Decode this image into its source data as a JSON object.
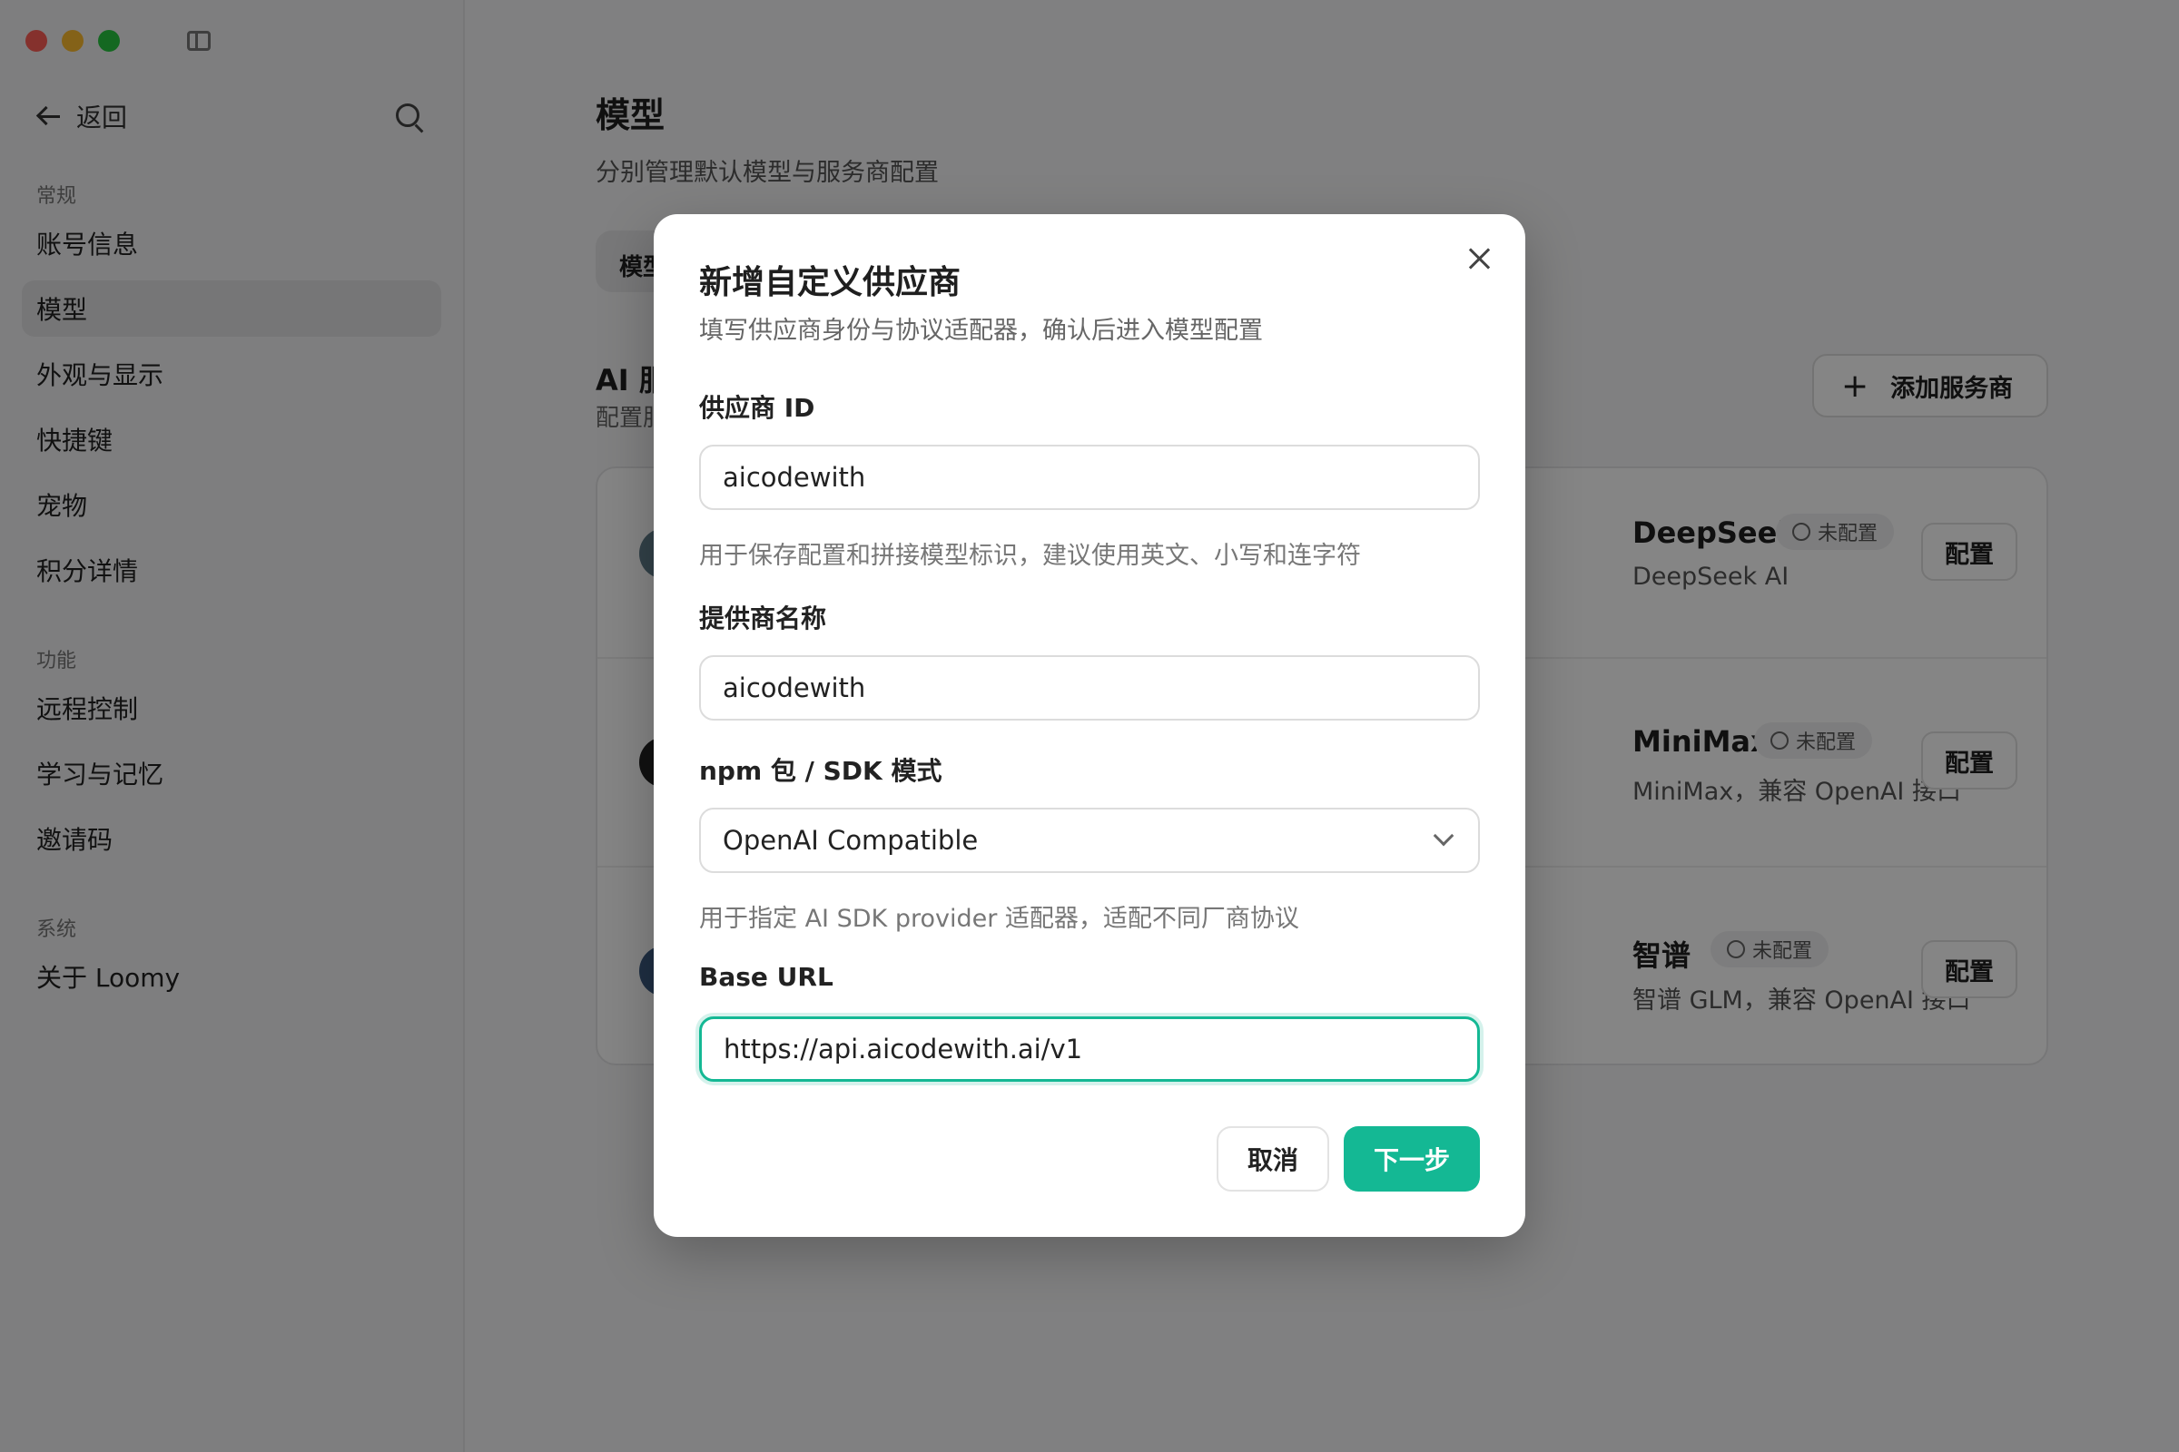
{
  "sidebar": {
    "back_label": "返回",
    "sections": [
      {
        "title": "常规",
        "items": [
          {
            "label": "账号信息"
          },
          {
            "label": "模型",
            "active": true
          },
          {
            "label": "外观与显示"
          },
          {
            "label": "快捷键"
          },
          {
            "label": "宠物"
          },
          {
            "label": "积分详情"
          }
        ]
      },
      {
        "title": "功能",
        "items": [
          {
            "label": "远程控制"
          },
          {
            "label": "学习与记忆"
          },
          {
            "label": "邀请码"
          }
        ]
      },
      {
        "title": "系统",
        "items": [
          {
            "label": "关于 Loomy"
          }
        ]
      }
    ]
  },
  "main": {
    "title": "模型",
    "subtitle": "分别管理默认模型与服务商配置",
    "tab_label": "模型",
    "ai_section_title": "AI 服务商",
    "ai_section_sub": "配置服务商",
    "add_provider_label": "添加服务商",
    "providers": [
      {
        "name": "DeepSeek",
        "desc": "DeepSeek AI",
        "status": "未配置",
        "action": "配置"
      },
      {
        "name": "MiniMax",
        "desc": "MiniMax，兼容 OpenAI 接口",
        "status": "未配置",
        "action": "配置"
      },
      {
        "name": "智谱",
        "desc": "智谱 GLM，兼容 OpenAI 接口",
        "status": "未配置",
        "action": "配置"
      }
    ]
  },
  "modal": {
    "title": "新增自定义供应商",
    "subtitle": "填写供应商身份与协议适配器，确认后进入模型配置",
    "provider_id_label": "供应商 ID",
    "provider_id_value": "aicodewith",
    "provider_id_hint": "用于保存配置和拼接模型标识，建议使用英文、小写和连字符",
    "provider_name_label": "提供商名称",
    "provider_name_value": "aicodewith",
    "sdk_label": "npm 包 / SDK 模式",
    "sdk_value": "OpenAI Compatible",
    "sdk_hint": "用于指定 AI SDK provider 适配器，适配不同厂商协议",
    "base_url_label": "Base URL",
    "base_url_value": "https://api.aicodewith.ai/v1",
    "cancel_label": "取消",
    "next_label": "下一步"
  },
  "colors": {
    "accent": "#14b894",
    "overlay": "rgba(0,0,0,0.48)"
  }
}
